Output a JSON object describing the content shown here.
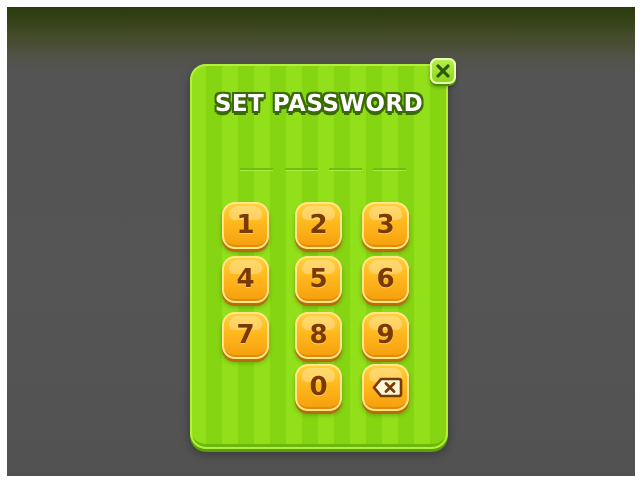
{
  "dialog": {
    "title": "SET PASSWORD",
    "close_icon": "close-x-icon",
    "password_slots": 4
  },
  "keypad": {
    "keys": [
      "1",
      "2",
      "3",
      "4",
      "5",
      "6",
      "7",
      "8",
      "9",
      "0"
    ],
    "backspace_icon": "backspace-icon"
  },
  "colors": {
    "panel_green": "#92e01a",
    "key_orange": "#ffb81e",
    "key_text": "#7a3a04",
    "title_outline": "#3a6a06",
    "background": "#555555"
  }
}
